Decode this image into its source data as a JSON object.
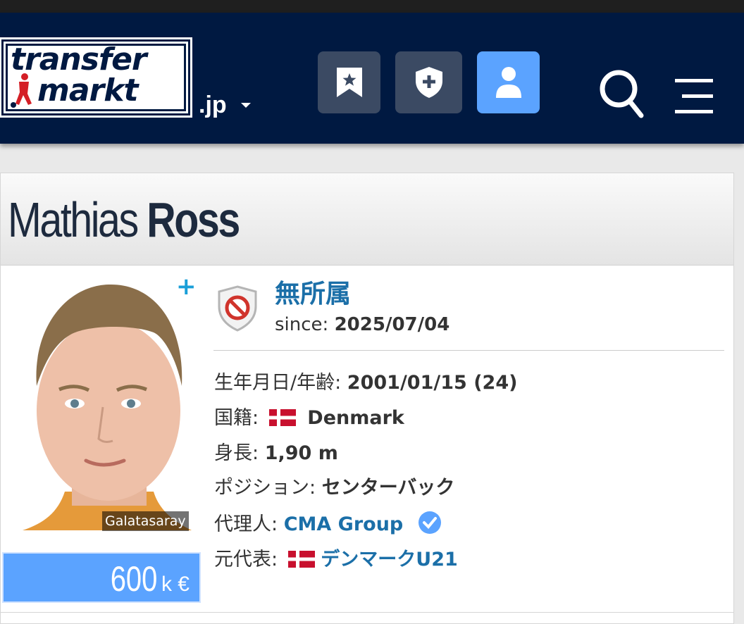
{
  "header": {
    "logo_line1": "transfer",
    "logo_line2": "markt",
    "domain": ".jp"
  },
  "player": {
    "first_name": "Mathias",
    "last_name": "Ross",
    "photo_caption": "Galatasaray",
    "market_value_number": "600",
    "market_value_unit": "k €"
  },
  "club": {
    "name": "無所属",
    "since_label": "since:",
    "since_date": "2025/07/04"
  },
  "details": {
    "dob_label": "生年月日/年齢:",
    "dob_value": "2001/01/15 (24)",
    "nationality_label": "国籍:",
    "nationality_value": "Denmark",
    "height_label": "身長:",
    "height_value": "1,90 m",
    "position_label": "ポジション:",
    "position_value": "センターバック",
    "agent_label": "代理人:",
    "agent_value": "CMA Group",
    "national_label": "元代表:",
    "national_value": "デンマークU21"
  },
  "colors": {
    "header_bg": "#001941",
    "accent_blue": "#5ba3ff",
    "link_blue": "#1b6fa8"
  }
}
